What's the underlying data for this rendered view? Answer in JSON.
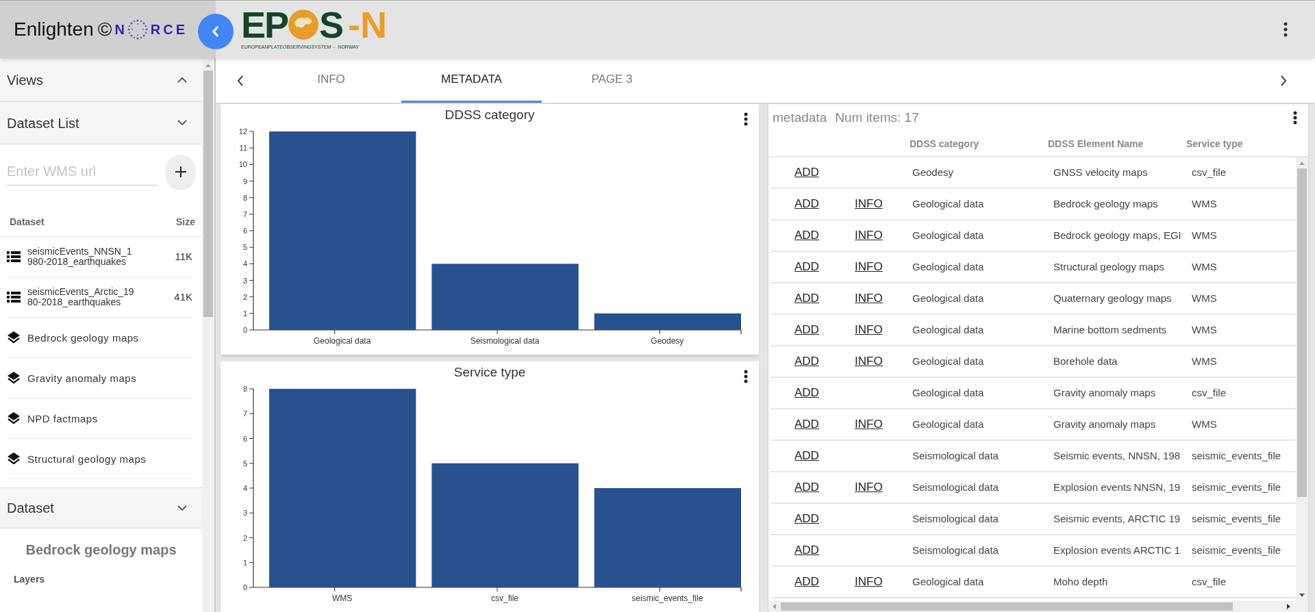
{
  "header": {
    "app_title": "Enlighten",
    "copyright": "©",
    "brand": {
      "first": "N",
      "rest": "RCE"
    },
    "logo": {
      "left": "EP",
      "right": "S",
      "suffix": "-N",
      "subtitle": "EUROPEANPLATEOBSERVINGSYSTEM  -  NORWAY"
    }
  },
  "sidebar": {
    "sections": [
      {
        "title": "Views",
        "expanded": true
      },
      {
        "title": "Dataset List",
        "expanded": false
      }
    ],
    "wms_input": {
      "placeholder": "Enter WMS url"
    },
    "dataset_table": {
      "columns": [
        "Dataset",
        "Size"
      ],
      "items": [
        {
          "kind": "table",
          "name": "seismicEvents_NNSN_1980-2018_earthquakes",
          "size": "11K"
        },
        {
          "kind": "table",
          "name": "seismicEvents_Arctic_1980-2018_earthquakes",
          "size": "41K"
        },
        {
          "kind": "layer",
          "name": "Bedrock geology maps"
        },
        {
          "kind": "layer",
          "name": "Gravity anomaly maps"
        },
        {
          "kind": "layer",
          "name": "NPD factmaps"
        },
        {
          "kind": "layer",
          "name": "Structural geology maps"
        }
      ]
    },
    "dataset_section": {
      "title": "Dataset",
      "expanded": false,
      "selected_name": "Bedrock geology maps",
      "layers_label": "Layers"
    }
  },
  "tabs": [
    {
      "label": "INFO",
      "selected": false
    },
    {
      "label": "METADATA",
      "selected": true
    },
    {
      "label": "PAGE 3",
      "selected": false
    }
  ],
  "charts": [
    {
      "chart_data": {
        "type": "bar",
        "title": "DDSS category",
        "categories": [
          "Geological data",
          "Seismological data",
          "Geodesy"
        ],
        "series": [
          {
            "color": "#27518f",
            "values": [
              12,
              4,
              1
            ]
          }
        ],
        "ylim": [
          0,
          12
        ],
        "yticks": [
          0,
          1,
          2,
          3,
          4,
          5,
          6,
          7,
          8,
          9,
          10,
          11,
          12
        ]
      }
    },
    {
      "chart_data": {
        "type": "bar",
        "title": "Service type",
        "categories": [
          "WMS",
          "csv_file",
          "seismic_events_file"
        ],
        "series": [
          {
            "color": "#27518f",
            "values": [
              8,
              5,
              4
            ]
          }
        ],
        "ylim": [
          0,
          8
        ],
        "yticks": [
          0,
          1,
          2,
          3,
          4,
          5,
          6,
          7,
          8
        ]
      }
    }
  ],
  "table": {
    "title": "metadata",
    "count": "Num items: 17",
    "columns": [
      "DDSS category",
      "DDSS Element Name",
      "Service type"
    ],
    "rows": [
      {
        "add": "ADD",
        "category": "Geodesy",
        "element": "GNSS velocity maps",
        "service": "csv_file"
      },
      {
        "add": "ADD",
        "info": "INFO",
        "category": "Geological data",
        "element": "Bedrock geology maps",
        "service": "WMS"
      },
      {
        "add": "ADD",
        "info": "INFO",
        "category": "Geological data",
        "element": "Bedrock geology maps, EGI",
        "service": "WMS"
      },
      {
        "add": "ADD",
        "info": "INFO",
        "category": "Geological data",
        "element": "Structural geology maps",
        "service": "WMS"
      },
      {
        "add": "ADD",
        "info": "INFO",
        "category": "Geological data",
        "element": "Quaternary geology maps",
        "service": "WMS"
      },
      {
        "add": "ADD",
        "info": "INFO",
        "category": "Geological data",
        "element": "Marine bottom sedments",
        "service": "WMS"
      },
      {
        "add": "ADD",
        "info": "INFO",
        "category": "Geological data",
        "element": "Borehole data",
        "service": "WMS"
      },
      {
        "add": "ADD",
        "category": "Geological data",
        "element": "Gravity anomaly maps",
        "service": "csv_file"
      },
      {
        "add": "ADD",
        "info": "INFO",
        "category": "Geological data",
        "element": "Gravity anomaly maps",
        "service": "WMS"
      },
      {
        "add": "ADD",
        "category": "Seismological data",
        "element": "Seismic events, NNSN, 198",
        "service": "seismic_events_file"
      },
      {
        "add": "ADD",
        "info": "INFO",
        "category": "Seismological data",
        "element": "Explosion events NNSN, 19",
        "service": "seismic_events_file"
      },
      {
        "add": "ADD",
        "category": "Seismological data",
        "element": "Seismic events, ARCTIC 19",
        "service": "seismic_events_file"
      },
      {
        "add": "ADD",
        "category": "Seismological data",
        "element": "Explosion events ARCTIC 1",
        "service": "seismic_events_file"
      },
      {
        "add": "ADD",
        "info": "INFO",
        "category": "Geological data",
        "element": "Moho depth",
        "service": "csv_file"
      }
    ]
  }
}
